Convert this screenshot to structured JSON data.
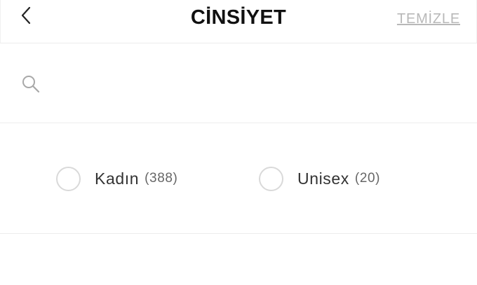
{
  "header": {
    "title": "CİNSİYET",
    "clear_label": "TEMİZLE",
    "back_icon": "chevron-left-icon"
  },
  "search": {
    "icon": "search-icon",
    "value": "",
    "placeholder": ""
  },
  "options": [
    {
      "label": "Kadın",
      "count": "(388)",
      "selected": false
    },
    {
      "label": "Unisex",
      "count": "(20)",
      "selected": false
    }
  ],
  "colors": {
    "clear_link": "#b8b8b8",
    "divider": "#ececec",
    "radio_border": "#d9d9d9"
  }
}
